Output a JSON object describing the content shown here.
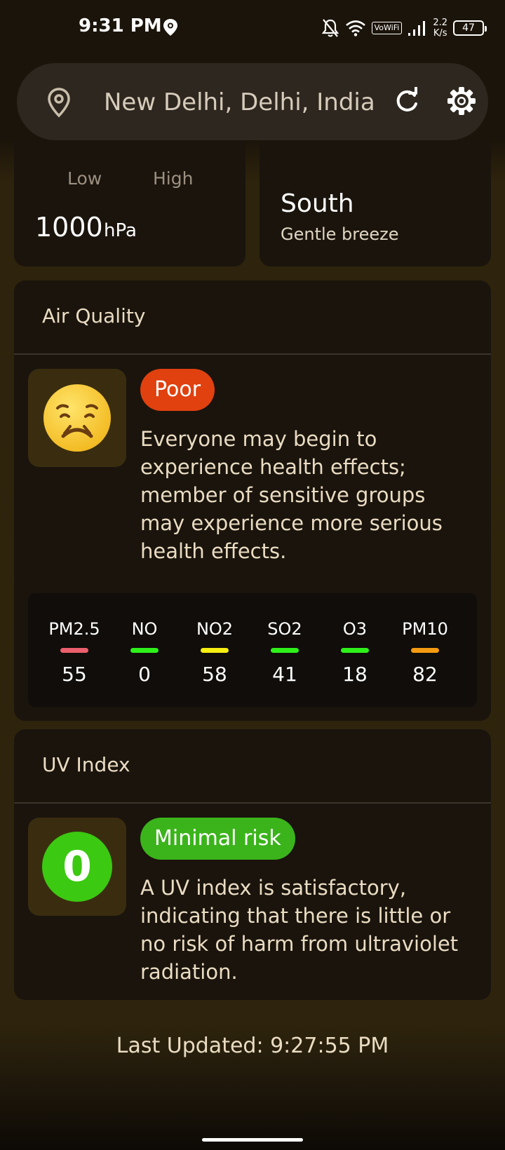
{
  "status_bar": {
    "time": "9:31 PM",
    "icons": [
      "location-icon",
      "bell-off-icon",
      "wifi-icon",
      "vowifi-icon",
      "signal-icon",
      "battery-icon"
    ],
    "vowifi": "VoWiFi",
    "speed_value": "2.2",
    "speed_unit": "K/s",
    "battery": "47"
  },
  "search": {
    "location": "New Delhi, Delhi, India",
    "icons": [
      "map-pin-icon",
      "refresh-icon",
      "settings-icon"
    ]
  },
  "pressure_card": {
    "low_label": "Low",
    "high_label": "High",
    "value": "1000",
    "unit": "hPa"
  },
  "wind_card": {
    "direction": "South",
    "description": "Gentle breeze"
  },
  "air_quality": {
    "title": "Air Quality",
    "status": "Poor",
    "status_color": "#e0410f",
    "description": "Everyone may begin to experience health effects; member of sensitive groups may experience more serious health effects.",
    "pollutants": [
      {
        "name": "PM2.5",
        "value": "55",
        "color": "#ec5f6c"
      },
      {
        "name": "NO",
        "value": "0",
        "color": "#2ef11a"
      },
      {
        "name": "NO2",
        "value": "58",
        "color": "#f7ee12"
      },
      {
        "name": "SO2",
        "value": "41",
        "color": "#2ef11a"
      },
      {
        "name": "O3",
        "value": "18",
        "color": "#2ef11a"
      },
      {
        "name": "PM10",
        "value": "82",
        "color": "#f59b12"
      }
    ]
  },
  "uv_index": {
    "title": "UV Index",
    "value": "0",
    "risk": "Minimal risk",
    "risk_color": "#3bb41b",
    "description": "A UV index is satisfactory, indicating that there is little or no risk of harm from ultraviolet radiation."
  },
  "footer": {
    "last_updated": "Last Updated: 9:27:55 PM"
  }
}
